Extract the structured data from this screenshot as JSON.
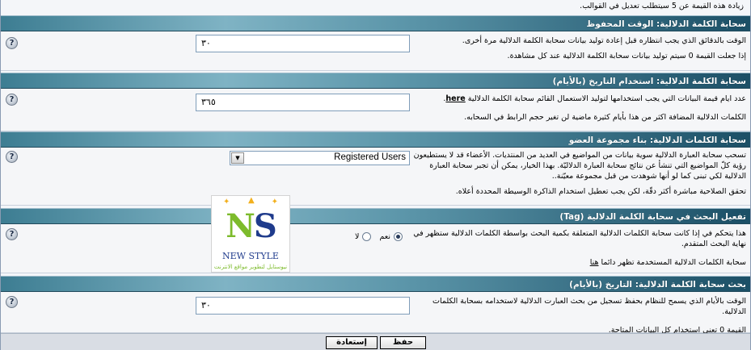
{
  "top_note": "زيادة هذه القيمة عن 5 سيتطلب تعديل في القوالب.",
  "help_label": "?",
  "sections": [
    {
      "title": "سحابة الكلمة الدلالية: الوقت المحفوظ",
      "desc": [
        "الوقت بالدقائق الذي يجب انتظاره قبل إعادة توليد بيانات سحابة الكلمة الدلالية مرة أخرى.",
        "إذا جعلت القيمة 0 سيتم توليد بيانات سحابة الكلمة الدلالية عند كل مشاهدة."
      ],
      "value": "٣٠"
    },
    {
      "title": "سحابة الكلمة الدلالية: استخدام التاريخ (بالأيام)",
      "desc_pre": "عدد ايام قيمة البيانات التي يجب استخدامها لتوليد الاستعمال القائم سحابة الكلمة الدلالية",
      "desc_link": "here",
      "desc_post": ".",
      "desc2": "الكلمات الدلالية المضافة اكثر من هذا بأيام كثيرة ماضية لن تغير حجم الرابط في السحابه.",
      "value": "٣٦٥"
    },
    {
      "title": "سحابة الكلمات الدلالية: بناء مجموعة العضو",
      "desc": [
        "تسحب سحابة العبارة الدلالية سوية بيانات من المواضيع في العديد من المنتديات. الأعضاء قد لا يستطيعون رؤية كلّ المواضيع التي تنشأ عن نتائج سحابة العبارة الدلاليّة. بهذا الخيار، يمكن أن تجبر سحابة العبارة الدلالية لكي تبنى كما لو أنها شوهدت من قبل مجموعة معيّنة..",
        "تحقق الصلاحية مباشرة أكثر دقّة، لكن يجب تعطيل استخدام الذاكرة الوسيطة المحددة أعلاه."
      ],
      "select_value": "Registered Users"
    },
    {
      "title": "تفعيل البحث في سحابة الكلمة الدلالية (Tag)",
      "desc": [
        "هذا يتحكم في إذا كانت سحابة الكلمات الدلالية المتعلقة بكمية البحث بواسطة الكلمات الدلالية ستظهر في نهاية البحث المتقدم."
      ],
      "desc2_pre": "سحابة الكلمات الدلالية المستخدمة تظهر دائما",
      "desc2_link": "هنا",
      "radio_yes": "نعم",
      "radio_no": "لا"
    },
    {
      "title": "بحث سحابة الكلمة الدلالية: التاريخ (بالأيام)",
      "desc": [
        "الوقت بالأيام الذي يسمح للنظام بحفظ تسجيل من بحث العبارت الدلالية لاستخدامه بسحابة الكلمات الدلالية.",
        "القيمة 0 تعني استخدام كل البيانات المتاحة."
      ],
      "value": "٣٠"
    }
  ],
  "buttons": {
    "save": "حفظ",
    "reset": "إستعادة"
  },
  "logo": {
    "letters_n": "N",
    "letters_s": "S",
    "brand": "NEW STYLE",
    "tagline": "نيوستايل لتطوير مواقع الانترنت"
  }
}
